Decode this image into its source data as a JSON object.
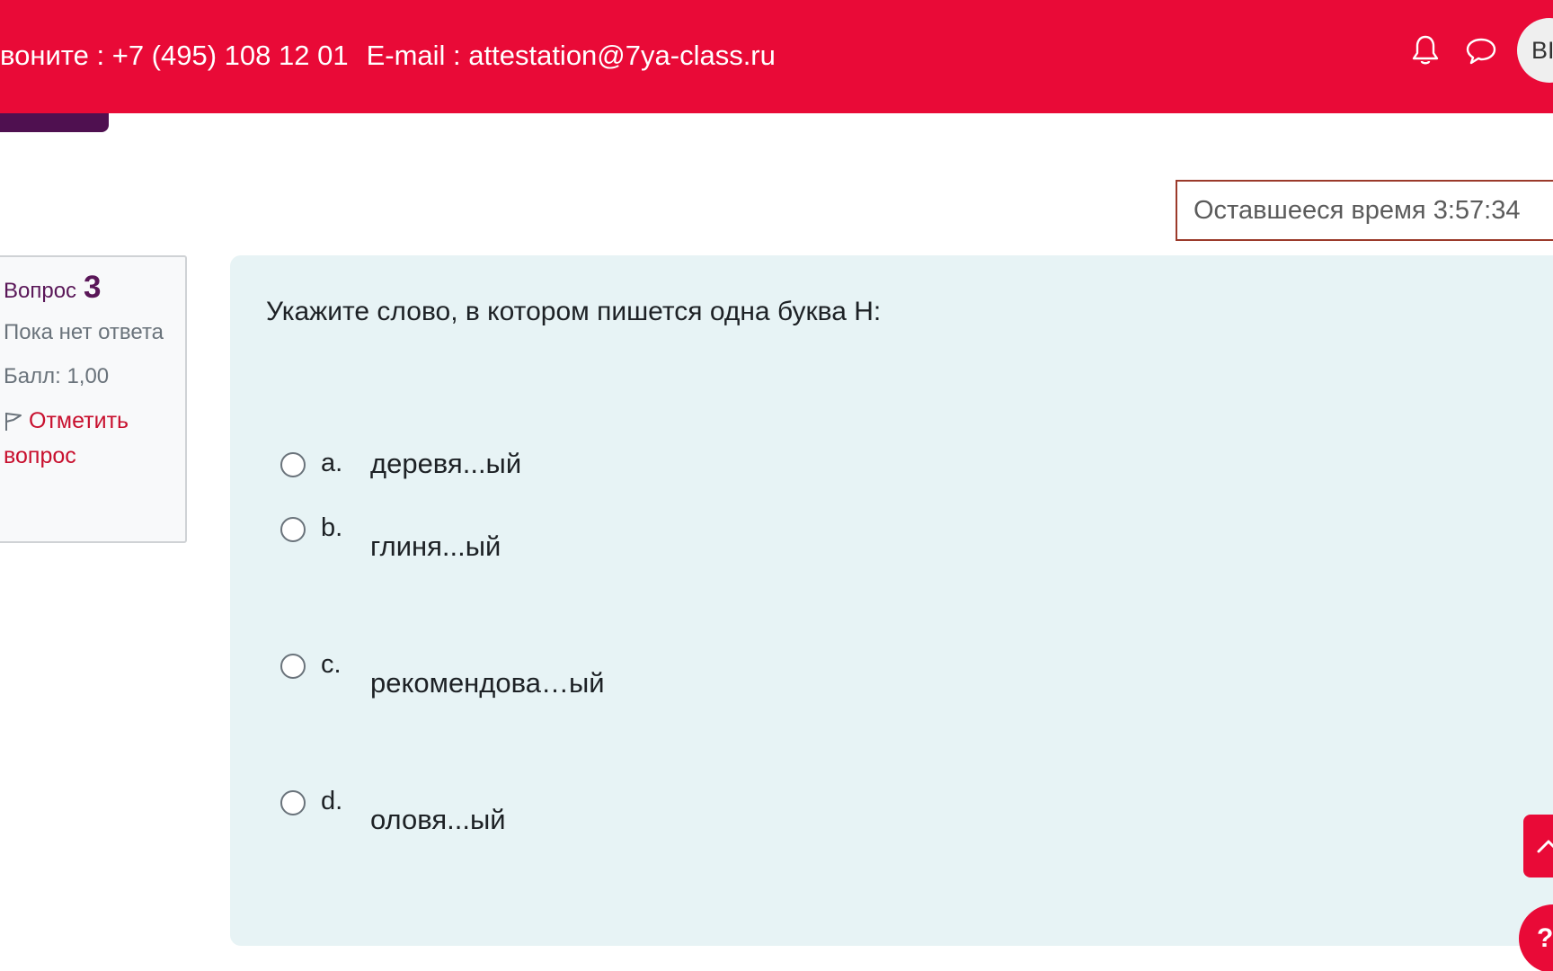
{
  "header": {
    "phone_text": "воните : +7 (495) 108 12 01",
    "email_text": "E-mail : attestation@7ya-class.ru",
    "avatar_initials": "ВІ",
    "icons": [
      "bell-icon",
      "chat-icon"
    ],
    "accent_color": "#e90a37"
  },
  "timer": {
    "text": "Оставшееся время 3:57:34"
  },
  "question_info": {
    "label": "Вопрос",
    "number": "3",
    "state": "Пока нет ответа",
    "grade": "Балл: 1,00",
    "flag_label": "Отметить вопрос"
  },
  "question": {
    "text": "Укажите слово, в котором пишется одна буква Н:",
    "options": [
      {
        "letter": "a.",
        "text": "деревя...ый"
      },
      {
        "letter": "b.",
        "text": "глиня...ый"
      },
      {
        "letter": "c.",
        "text": "рекомендова…ый"
      },
      {
        "letter": "d.",
        "text": "оловя...ый"
      }
    ]
  },
  "floating": {
    "help_label": "?",
    "scroll_icon": "chevron-up-icon"
  }
}
